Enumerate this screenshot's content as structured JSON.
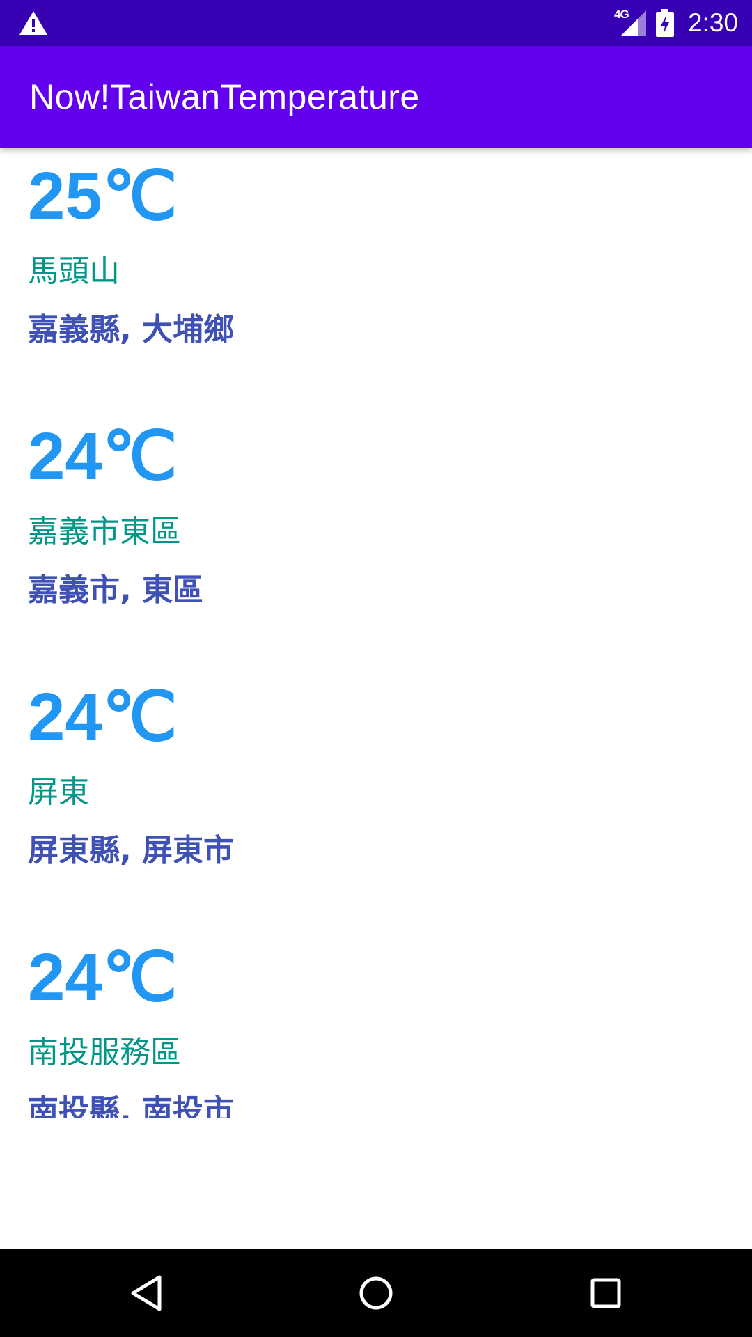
{
  "status_bar": {
    "network_label": "4G",
    "time": "2:30",
    "icons": [
      "warning-icon",
      "signal-icon",
      "battery-charging-icon"
    ],
    "background_color": "#3700b3"
  },
  "app_bar": {
    "title": "Now!TaiwanTemperature",
    "background_color": "#6200ee"
  },
  "colors": {
    "temperature": "#2196f3",
    "station": "#009688",
    "location": "#3f51b5"
  },
  "readings": [
    {
      "temperature": "25℃",
      "station": "馬頭山",
      "location": "嘉義縣, 大埔鄉"
    },
    {
      "temperature": "24℃",
      "station": "嘉義市東區",
      "location": "嘉義市, 東區"
    },
    {
      "temperature": "24℃",
      "station": "屏東",
      "location": "屏東縣, 屏東市"
    },
    {
      "temperature": "24℃",
      "station": "南投服務區",
      "location": "南投縣, 南投市"
    }
  ],
  "nav_bar": {
    "icons": [
      "back-icon",
      "home-icon",
      "recents-icon"
    ]
  }
}
